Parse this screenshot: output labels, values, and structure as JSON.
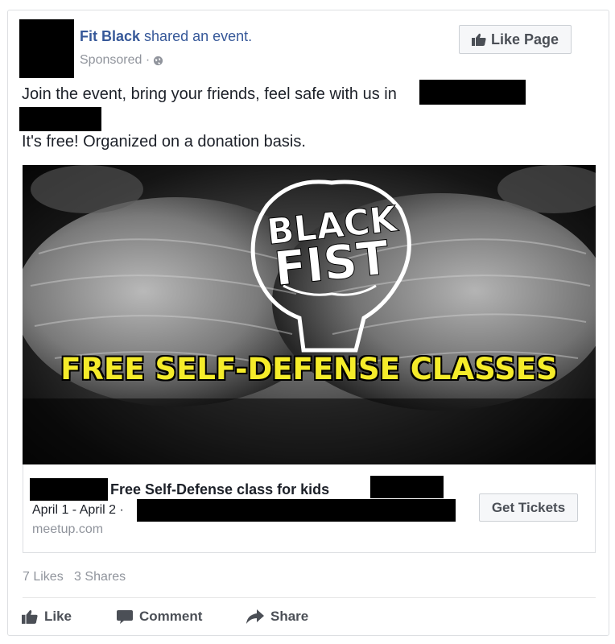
{
  "post": {
    "author": "Fit Black",
    "action": "shared an event.",
    "sponsored": "Sponsored ·",
    "like_page_label": "Like Page",
    "text_line1": "Join the event, bring your friends, feel safe with us in",
    "text_line3": "It's free! Organized on a donation basis."
  },
  "image": {
    "logo_line1": "BLACK",
    "logo_line2": "FIST",
    "headline": "FREE SELF-DEFENSE CLASSES",
    "headline_color": "#f5ec2a"
  },
  "event": {
    "title": "Free Self-Defense class for kids",
    "dates": "April 1 - April 2 ·",
    "domain": "meetup.com",
    "tickets_label": "Get Tickets"
  },
  "stats": {
    "likes": "7 Likes",
    "shares": "3 Shares"
  },
  "actions": {
    "like": "Like",
    "comment": "Comment",
    "share": "Share"
  },
  "colors": {
    "link_blue": "#365899",
    "muted_gray": "#90949c"
  }
}
